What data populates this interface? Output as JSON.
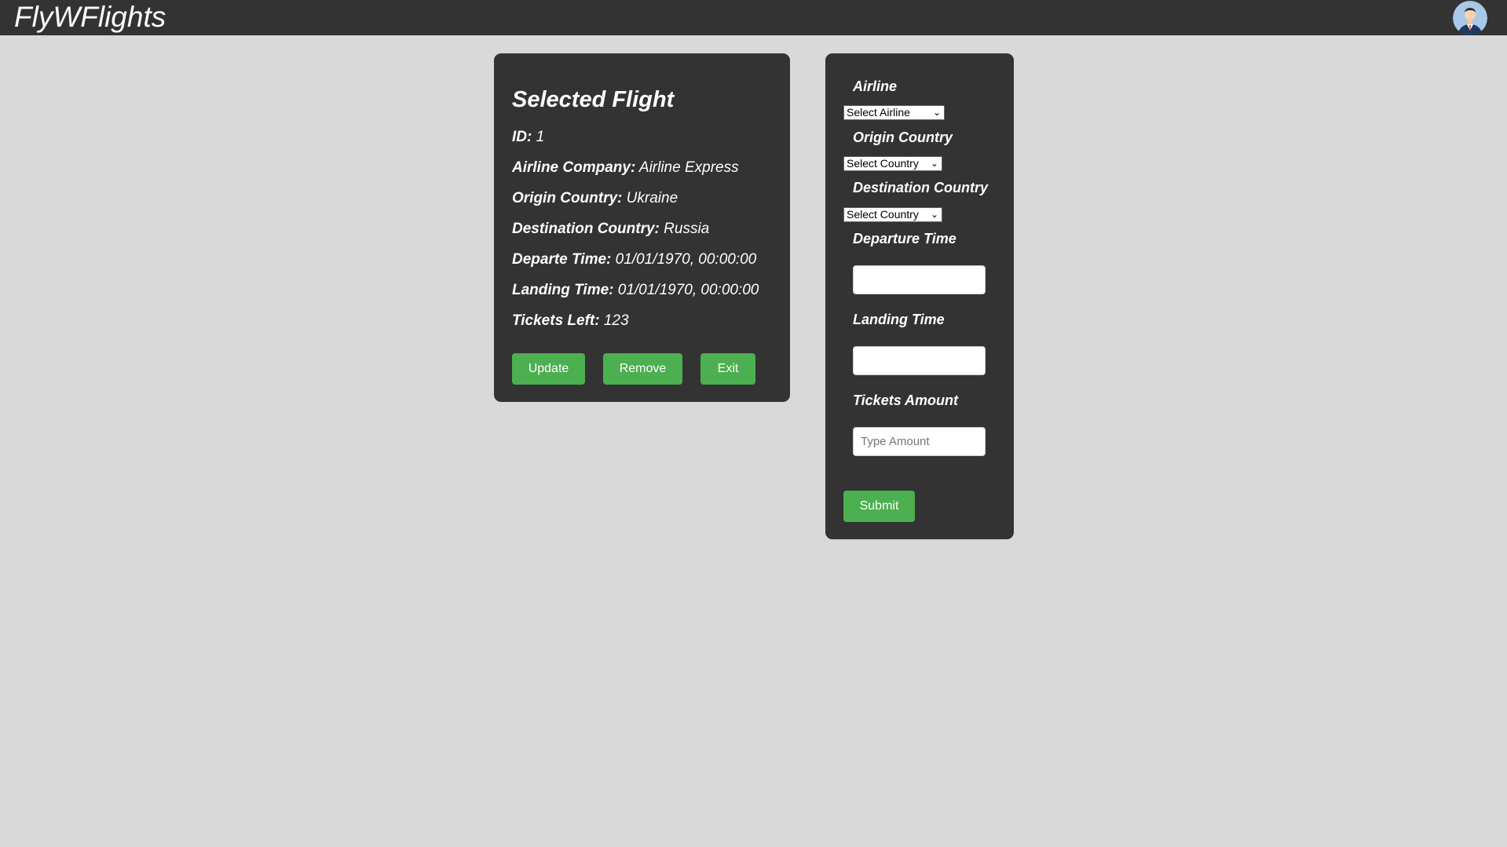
{
  "app": {
    "brand": "FlyWFlights"
  },
  "flight": {
    "title": "Selected Flight",
    "fields": [
      {
        "label": "ID:",
        "value": "1"
      },
      {
        "label": "Airline Company:",
        "value": "Airline Express"
      },
      {
        "label": "Origin Country:",
        "value": "Ukraine"
      },
      {
        "label": "Destination Country:",
        "value": "Russia"
      },
      {
        "label": "Departe Time:",
        "value": "01/01/1970, 00:00:00"
      },
      {
        "label": "Landing Time:",
        "value": "01/01/1970, 00:00:00"
      },
      {
        "label": "Tickets Left:",
        "value": "123"
      }
    ],
    "buttons": {
      "update": "Update",
      "remove": "Remove",
      "exit": "Exit"
    }
  },
  "form": {
    "airline_label": "Airline",
    "airline_select": "Select Airline",
    "origin_label": "Origin Country",
    "origin_select": "Select Country",
    "destination_label": "Destination Country",
    "destination_select": "Select Country",
    "departure_label": "Departure Time",
    "departure_value": "",
    "landing_label": "Landing Time",
    "landing_value": "",
    "tickets_label": "Tickets Amount",
    "tickets_placeholder": "Type Amount",
    "submit": "Submit"
  },
  "colors": {
    "background": "#d9d9d9",
    "panel": "#333333",
    "accent": "#4caf50"
  },
  "icons": {
    "avatar": "user-avatar-icon",
    "chevron": "chevron-down-icon"
  }
}
